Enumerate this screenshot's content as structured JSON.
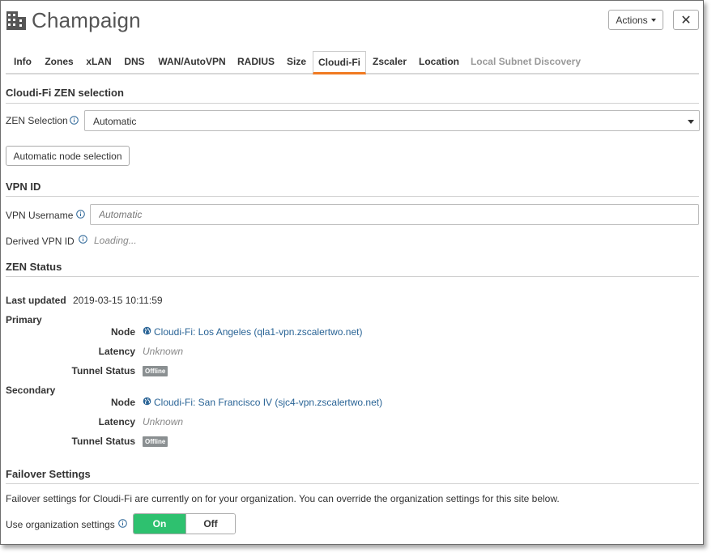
{
  "header": {
    "title": "Champaign",
    "actions_label": "Actions",
    "close_label": "✕"
  },
  "tabs": [
    {
      "label": "Info"
    },
    {
      "label": "Zones"
    },
    {
      "label": "xLAN"
    },
    {
      "label": "DNS"
    },
    {
      "label": "WAN/AutoVPN"
    },
    {
      "label": "RADIUS"
    },
    {
      "label": "Size"
    },
    {
      "label": "Cloudi-Fi",
      "active": true
    },
    {
      "label": "Zscaler"
    },
    {
      "label": "Location"
    },
    {
      "label": "Local Subnet Discovery",
      "disabled": true
    }
  ],
  "zen_selection": {
    "title": "Cloudi-Fi ZEN selection",
    "label": "ZEN Selection",
    "value": "Automatic",
    "button_label": "Automatic node selection"
  },
  "vpn_id": {
    "title": "VPN ID",
    "username_label": "VPN Username",
    "username_placeholder": "Automatic",
    "derived_label": "Derived VPN ID",
    "derived_value": "Loading..."
  },
  "zen_status": {
    "title": "ZEN Status",
    "last_updated_label": "Last updated",
    "last_updated_value": "2019-03-15 10:11:59",
    "node_label": "Node",
    "latency_label": "Latency",
    "tunnel_label": "Tunnel Status",
    "primary": {
      "label": "Primary",
      "node": "Cloudi-Fi: Los Angeles (qla1-vpn.zscalertwo.net)",
      "latency": "Unknown",
      "tunnel_status": "Offline"
    },
    "secondary": {
      "label": "Secondary",
      "node": "Cloudi-Fi: San Francisco IV (sjc4-vpn.zscalertwo.net)",
      "latency": "Unknown",
      "tunnel_status": "Offline"
    }
  },
  "failover": {
    "title": "Failover Settings",
    "description": "Failover settings for Cloudi-Fi are currently on for your organization. You can override the organization settings for this site below.",
    "org_settings_label": "Use organization settings",
    "on_label": "On",
    "off_label": "Off",
    "selected": "On"
  },
  "colors": {
    "active_tab_accent": "#f07a21",
    "toggle_on": "#2ec16f",
    "link": "#2a6496",
    "badge": "#8a8f91"
  }
}
